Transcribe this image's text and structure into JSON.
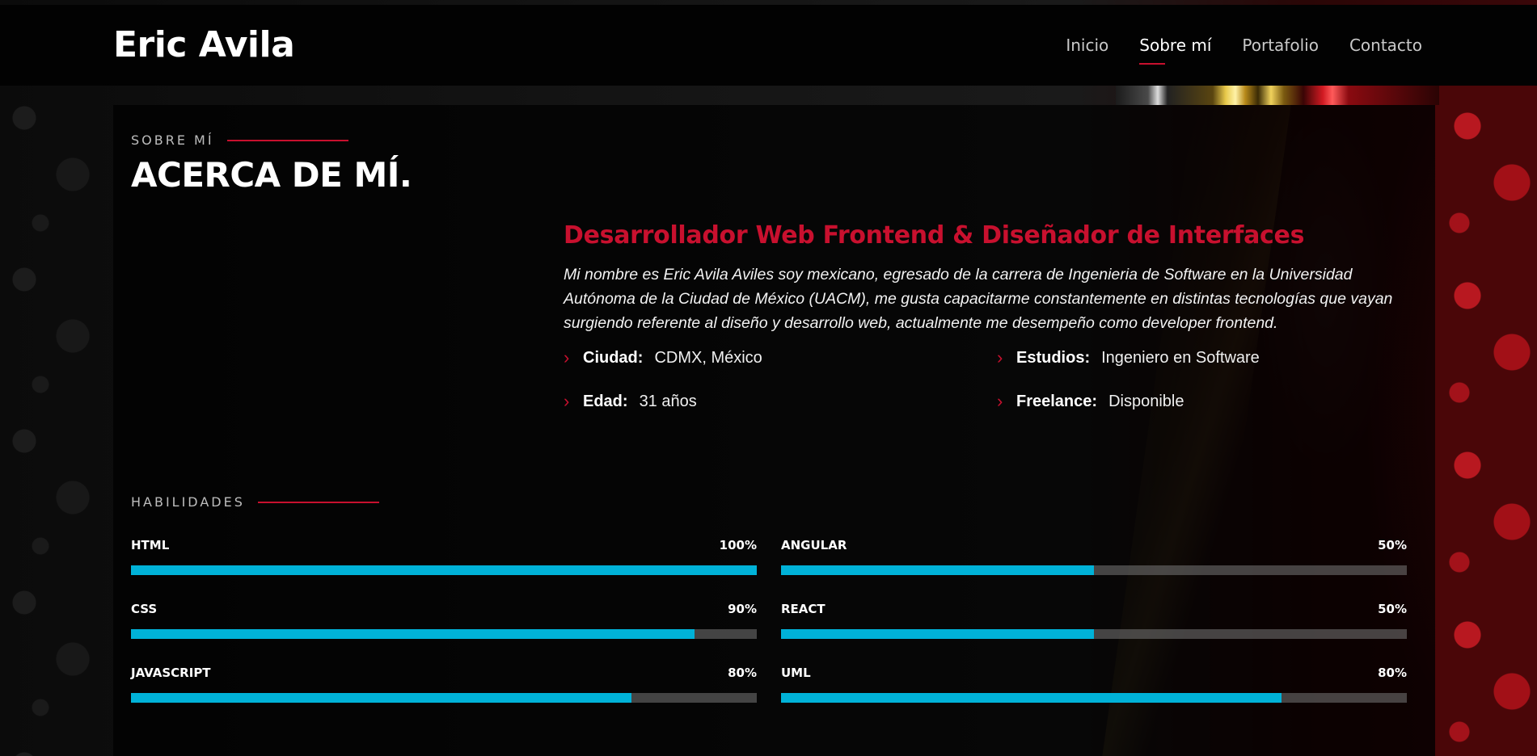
{
  "header": {
    "brand": "Eric Avila",
    "nav": [
      {
        "label": "Inicio",
        "active": false
      },
      {
        "label": "Sobre mí",
        "active": true
      },
      {
        "label": "Portafolio",
        "active": false
      },
      {
        "label": "Contacto",
        "active": false
      }
    ]
  },
  "about": {
    "eyebrow": "SOBRE MÍ",
    "title": "ACERCA DE MÍ.",
    "role": "Desarrollador Web Frontend & Diseñador de Interfaces",
    "bio": "Mi nombre es Eric Avila Aviles soy mexicano, egresado de la carrera de Ingenieria de Software en la Universidad Autónoma de la Ciudad de México (UACM), me gusta capacitarme constantemente en distintas tecnologías que vayan surgiendo referente al diseño y desarrollo web, actualmente me desempeño como developer frontend.",
    "facts": [
      {
        "label": "Ciudad:",
        "value": "CDMX, México"
      },
      {
        "label": "Estudios:",
        "value": "Ingeniero en Software"
      },
      {
        "label": "Edad:",
        "value": "31 años"
      },
      {
        "label": "Freelance:",
        "value": "Disponible"
      }
    ]
  },
  "skills": {
    "eyebrow": "HABILIDADES",
    "items": [
      {
        "name": "HTML",
        "percent_label": "100%",
        "level": 1.0
      },
      {
        "name": "ANGULAR",
        "percent_label": "50%",
        "level": 0.5
      },
      {
        "name": "CSS",
        "percent_label": "90%",
        "level": 0.9
      },
      {
        "name": "REACT",
        "percent_label": "50%",
        "level": 0.5
      },
      {
        "name": "JAVASCRIPT",
        "percent_label": "80%",
        "level": 0.8
      },
      {
        "name": "UML",
        "percent_label": "80%",
        "level": 0.8
      }
    ]
  },
  "colors": {
    "accent_red": "#c8102e",
    "bar_fill": "#00b2d8",
    "bar_track": "#555555"
  },
  "icons": {
    "fact_bullet": "chevron-right-icon"
  }
}
